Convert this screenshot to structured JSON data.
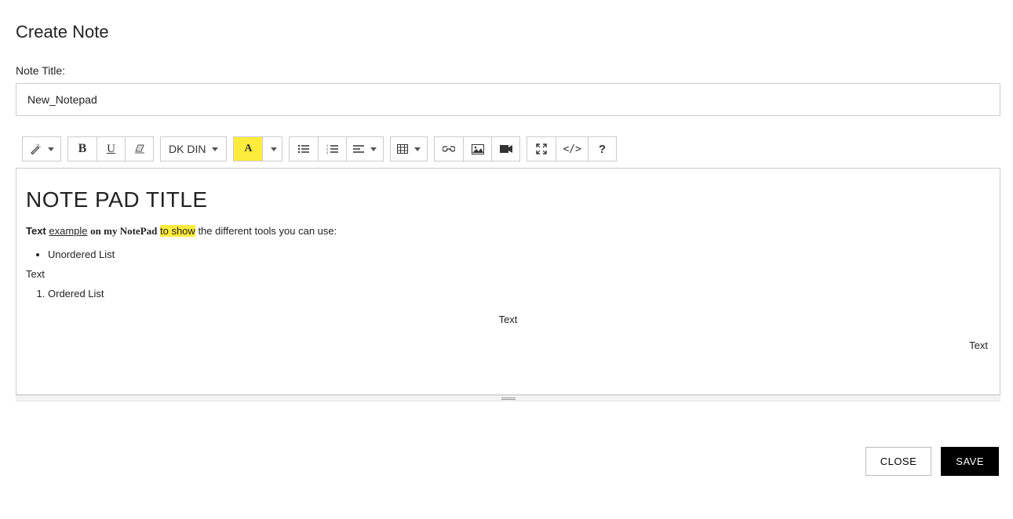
{
  "page": {
    "title": "Create Note"
  },
  "form": {
    "title_label": "Note Title:",
    "title_value": "New_Notepad"
  },
  "toolbar": {
    "font_family": "DK DIN",
    "font_symbol": "A"
  },
  "editor": {
    "heading": "NOTE PAD TITLE",
    "line1": {
      "p1": "Text",
      "p2": "example",
      "p3": "on my NotePad",
      "p4": "to show",
      "p5": "the different tools you can use:"
    },
    "ul_item": "Unordered List",
    "text_left": "Text",
    "ol_item": "Ordered List",
    "text_center": "Text",
    "text_right": "Text"
  },
  "actions": {
    "close": "CLOSE",
    "save": "SAVE"
  }
}
